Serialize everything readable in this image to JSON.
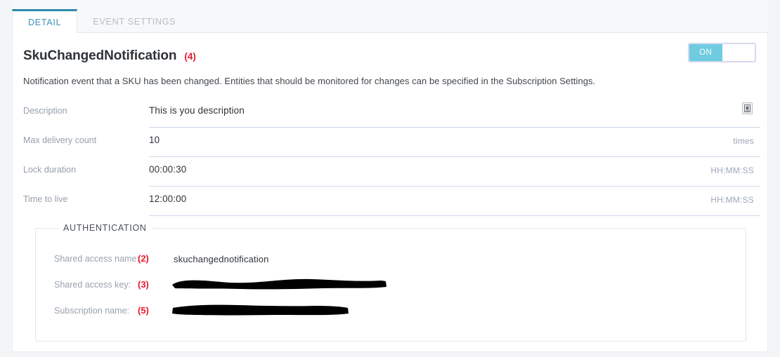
{
  "tabs": [
    {
      "label": "DETAIL",
      "active": true
    },
    {
      "label": "EVENT SETTINGS",
      "active": false
    }
  ],
  "header": {
    "title": "SkuChangedNotification",
    "annotation": "(4)",
    "description": "Notification event that a SKU has been changed. Entities that should be monitored for changes can be specified in the Subscription Settings.",
    "toggle": {
      "label": "ON",
      "state": "on",
      "on_color": "#6ecbe0"
    }
  },
  "form": {
    "fields": [
      {
        "label": "Description",
        "value": "This is you description",
        "suffix": "",
        "icon": "note-button-icon"
      },
      {
        "label": "Max delivery count",
        "value": "10",
        "suffix": "times",
        "icon": ""
      },
      {
        "label": "Lock duration",
        "value": "00:00:30",
        "suffix": "HH:MM:SS",
        "icon": ""
      },
      {
        "label": "Time to live",
        "value": "12:00:00",
        "suffix": "HH:MM:SS",
        "icon": ""
      }
    ]
  },
  "authentication": {
    "legend": "AUTHENTICATION",
    "rows": [
      {
        "label": "Shared access name:",
        "annotation": "(2)",
        "value": "skuchangednotification",
        "redacted": false,
        "redact_width": 0
      },
      {
        "label": "Shared access key:",
        "annotation": "(3)",
        "value": "",
        "redacted": true,
        "redact_width": 305
      },
      {
        "label": "Subscription name:",
        "annotation": "(5)",
        "value": "",
        "redacted": true,
        "redact_width": 250
      }
    ]
  },
  "colors": {
    "accent": "#2d8aa8",
    "annotation_red": "#e8192c",
    "toggle_on": "#6ecbe0",
    "page_bg": "#f4f5f7",
    "card_bg": "#ffffff"
  }
}
